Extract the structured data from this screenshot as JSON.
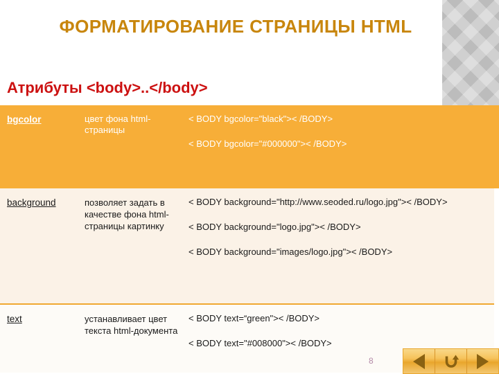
{
  "slide": {
    "title": "ФОРМАТИРОВАНИЕ СТРАНИЦЫ HTML",
    "subtitle": "Атрибуты <body>..</body>",
    "page_number": "8",
    "colors": {
      "title": "#C8860D",
      "subtitle": "#CC1111",
      "row_accent": "#F7AE38",
      "row_alt": "#FBF2E7",
      "page_number": "#B48AA8",
      "side_panel": "#BCBCBC"
    }
  },
  "table": {
    "rows": [
      {
        "attribute": "bgcolor",
        "description": "цвет фона html-страницы",
        "examples": [
          "< BODY bgcolor=\"black\">< /BODY>",
          "< BODY bgcolor=\"#000000\">< /BODY>"
        ]
      },
      {
        "attribute": "background",
        "description": "позволяет задать в качестве фона html-страницы картинку",
        "examples": [
          "< BODY background=\"http://www.seoded.ru/logo.jpg\">< /BODY>",
          "< BODY background=\"logo.jpg\">< /BODY>",
          "< BODY background=\"images/logo.jpg\">< /BODY>"
        ]
      },
      {
        "attribute": "text",
        "description": "устанавливает цвет текста html-документа",
        "examples": [
          "< BODY text=“green\">< /BODY>",
          "< BODY text=\"#008000\">< /BODY>"
        ]
      }
    ]
  },
  "nav": {
    "previous_label": "previous-slide",
    "return_label": "return-slide",
    "next_label": "next-slide"
  }
}
